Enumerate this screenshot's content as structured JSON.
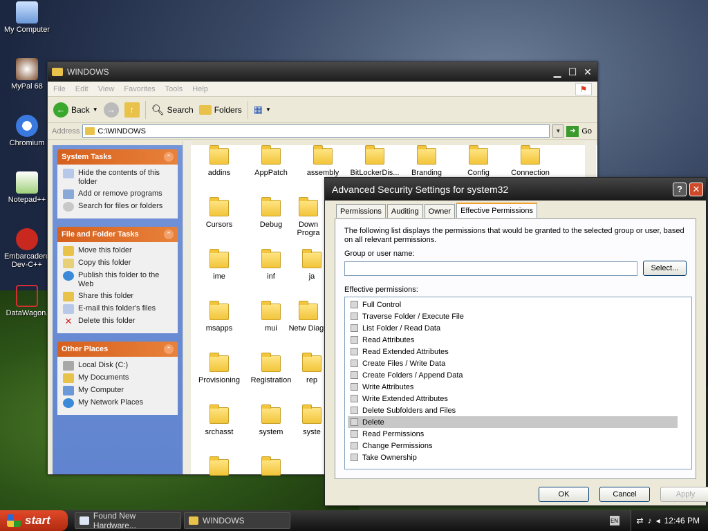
{
  "desktop": {
    "icons": [
      {
        "label": "My Computer"
      },
      {
        "label": "MyPal 68"
      },
      {
        "label": "Chromium"
      },
      {
        "label": "Notepad++"
      },
      {
        "label": "Embarcadero Dev-C++"
      },
      {
        "label": "DataWagon."
      }
    ]
  },
  "explorer": {
    "title": "WINDOWS",
    "menu": [
      "File",
      "Edit",
      "View",
      "Favorites",
      "Tools",
      "Help"
    ],
    "toolbar": {
      "back": "Back",
      "search": "Search",
      "folders": "Folders"
    },
    "address": {
      "label": "Address",
      "value": "C:\\WINDOWS",
      "go": "Go"
    },
    "tasks": {
      "system": {
        "title": "System Tasks",
        "items": [
          "Hide the contents of this folder",
          "Add or remove programs",
          "Search for files or folders"
        ]
      },
      "file_folder": {
        "title": "File and Folder Tasks",
        "items": [
          "Move this folder",
          "Copy this folder",
          "Publish this folder to the Web",
          "Share this folder",
          "E-mail this folder's files",
          "Delete this folder"
        ]
      },
      "other": {
        "title": "Other Places",
        "items": [
          "Local Disk (C:)",
          "My Documents",
          "My Computer",
          "My Network Places"
        ]
      }
    },
    "folders": [
      "addins",
      "AppPatch",
      "assembly",
      "BitLockerDis...",
      "Branding",
      "Config",
      "Connection",
      "Cursors",
      "Debug",
      "Down Progra",
      "ime",
      "inf",
      "ja",
      "msapps",
      "mui",
      "Netw Diagn",
      "Provisioning",
      "Registration",
      "rep",
      "srchasst",
      "system",
      "syste"
    ]
  },
  "dialog": {
    "title": "Advanced Security Settings for system32",
    "tabs": [
      "Permissions",
      "Auditing",
      "Owner",
      "Effective Permissions"
    ],
    "description": "The following list displays the permissions that would be granted to the selected group or user, based on all relevant permissions.",
    "group_label": "Group or user name:",
    "select_button": "Select...",
    "effective_label": "Effective permissions:",
    "permissions": [
      "Full Control",
      "Traverse Folder / Execute File",
      "List Folder / Read Data",
      "Read Attributes",
      "Read Extended Attributes",
      "Create Files / Write Data",
      "Create Folders / Append Data",
      "Write Attributes",
      "Write Extended Attributes",
      "Delete Subfolders and Files",
      "Delete",
      "Read Permissions",
      "Change Permissions",
      "Take Ownership"
    ],
    "selected_permission": "Delete",
    "buttons": {
      "ok": "OK",
      "cancel": "Cancel",
      "apply": "Apply"
    }
  },
  "taskbar": {
    "start": "start",
    "tasks": [
      "Found New Hardware...",
      "WINDOWS"
    ],
    "lang": "EN",
    "time": "12:46 PM"
  }
}
